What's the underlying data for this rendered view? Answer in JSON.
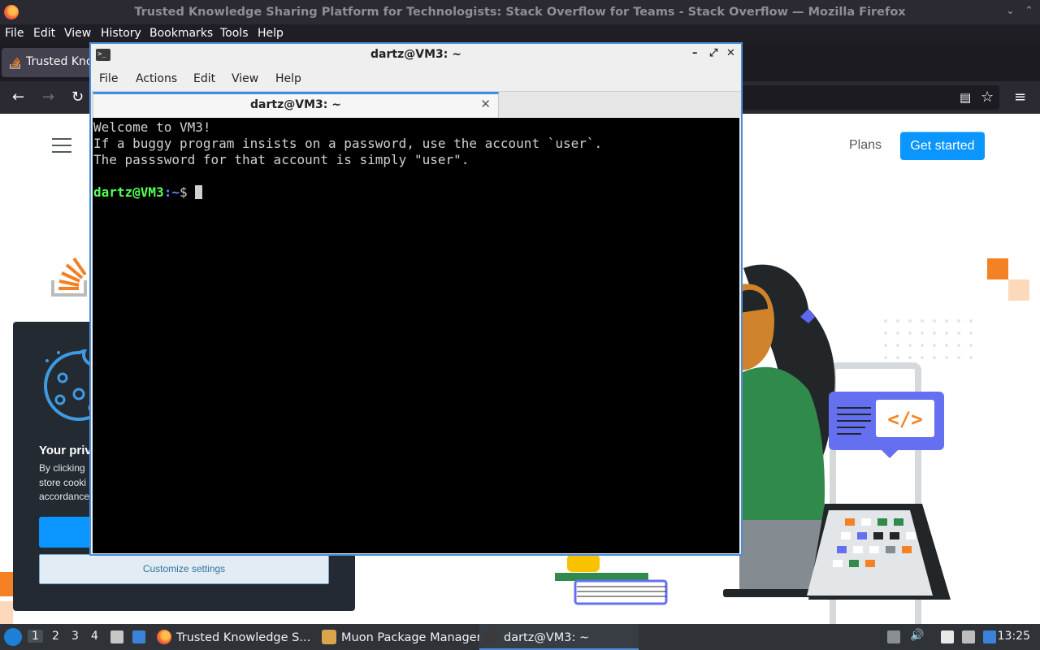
{
  "firefox": {
    "window_title": "Trusted Knowledge Sharing Platform for Technologists: Stack Overflow for Teams - Stack Overflow — Mozilla Firefox",
    "menu": [
      "File",
      "Edit",
      "View",
      "History",
      "Bookmarks",
      "Tools",
      "Help"
    ],
    "tab_label": "Trusted Kno"
  },
  "page": {
    "plans_label": "Plans",
    "get_started_label": "Get started",
    "cookie": {
      "heading": "Your priv",
      "body_lines": [
        "By clicking",
        "store cooki",
        "accordance"
      ],
      "customize_label": "Customize settings"
    }
  },
  "terminal": {
    "window_title": "dartz@VM3: ~",
    "menu": [
      "File",
      "Actions",
      "Edit",
      "View",
      "Help"
    ],
    "tab_label": "dartz@VM3: ~",
    "lines": [
      "Welcome to VM3!",
      "If a buggy program insists on a password, use the account `user`.",
      "The passsword for that account is simply \"user\"."
    ],
    "prompt_user": "dartz@VM3",
    "prompt_path": ":~",
    "prompt_symbol": "$ "
  },
  "taskbar": {
    "workspaces": [
      "1",
      "2",
      "3",
      "4"
    ],
    "tasks": [
      {
        "label": "Trusted Knowledge S...",
        "icon": "firefox-icon"
      },
      {
        "label": "Muon Package Manager",
        "icon": "package-icon"
      },
      {
        "label": "dartz@VM3: ~",
        "icon": "terminal-icon"
      }
    ],
    "clock": "13:25"
  }
}
